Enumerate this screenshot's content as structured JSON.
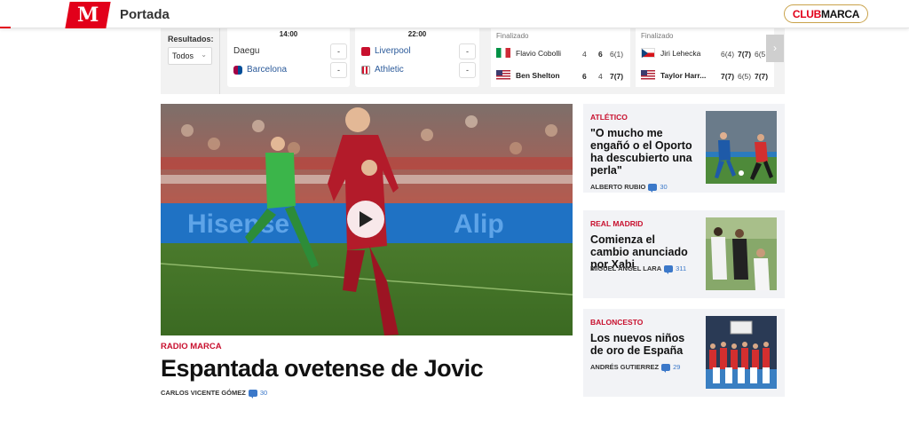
{
  "header": {
    "logo_letter": "M",
    "section_title": "Portada",
    "club_part1": "CLUB",
    "club_part2": "MARCA"
  },
  "scoreboard": {
    "results_label": "Resultados:",
    "filter_value": "Todos",
    "matches": [
      {
        "time": "14:00",
        "home": "Daegu",
        "away": "Barcelona",
        "home_score": "-",
        "away_score": "-"
      },
      {
        "time": "22:00",
        "home": "Liverpool",
        "away": "Athletic",
        "home_score": "-",
        "away_score": "-"
      }
    ],
    "tennis": [
      {
        "status": "Finalizado",
        "p1": {
          "name": "Flavio Cobolli",
          "sets": [
            "4",
            "6",
            "6(1)"
          ]
        },
        "p2": {
          "name": "Ben Shelton",
          "sets": [
            "6",
            "4",
            "7(7)"
          ]
        }
      },
      {
        "status": "Finalizado",
        "p1": {
          "name": "Jiri Lehecka",
          "sets": [
            "6(4)",
            "7(7)",
            "6(5"
          ]
        },
        "p2": {
          "name": "Taylor Harr...",
          "sets": [
            "7(7)",
            "6(5)",
            "7(7)"
          ]
        }
      }
    ]
  },
  "main_article": {
    "kicker": "RADIO MARCA",
    "title": "Espantada ovetense de Jovic",
    "author": "CARLOS VICENTE GÓMEZ",
    "comments": "30"
  },
  "side_articles": [
    {
      "kicker": "ATLÉTICO",
      "title": "\"O mucho me engañó o el Oporto ha descubierto una perla\"",
      "author": "ALBERTO RUBIO",
      "comments": "30"
    },
    {
      "kicker": "REAL MADRID",
      "title": "Comienza el cambio anunciado por Xabi",
      "author": "MIGUEL ÁNGEL LARA",
      "comments": "311"
    },
    {
      "kicker": "BALONCESTO",
      "title": "Los nuevos niños de oro de España",
      "author": "ANDRÉS GUTIERREZ",
      "comments": "29"
    }
  ],
  "colors": {
    "brand_red": "#e2001a",
    "link_blue": "#3b78c9",
    "kicker_red": "#c8102e"
  }
}
